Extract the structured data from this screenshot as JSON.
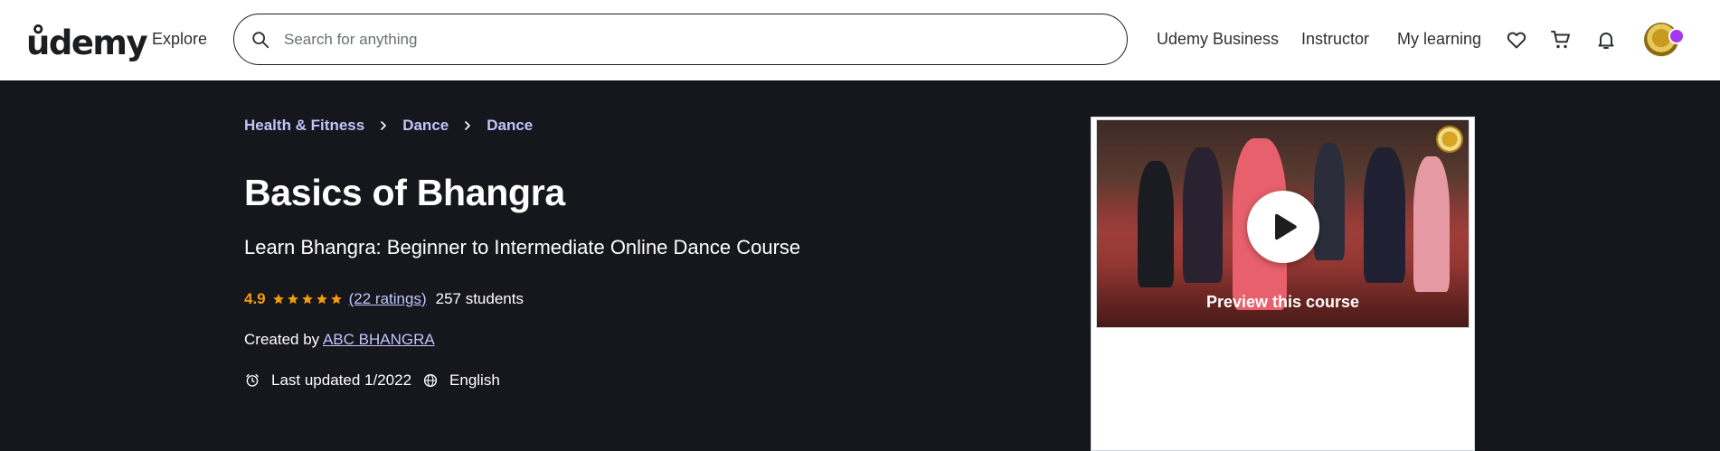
{
  "header": {
    "logo_text": "ůdemy",
    "explore_label": "Explore",
    "search_placeholder": "Search for anything",
    "nav_links": [
      "Udemy Business",
      "Instructor",
      "My learning"
    ],
    "brand_color": "#a435f0"
  },
  "course": {
    "breadcrumb": [
      "Health & Fitness",
      "Dance",
      "Dance"
    ],
    "title": "Basics of Bhangra",
    "subtitle": "Learn Bhangra: Beginner to Intermediate Online Dance Course",
    "rating": "4.9",
    "stars": 5,
    "ratings_link": "(22 ratings)",
    "students": "257 students",
    "created_by_label": "Created by",
    "author": "ABC BHANGRA",
    "last_updated": "Last updated 1/2022",
    "language": "English",
    "rating_color": "#f69c08",
    "link_color": "#c0c4fc"
  },
  "sidebar": {
    "preview_label": "Preview this course"
  }
}
